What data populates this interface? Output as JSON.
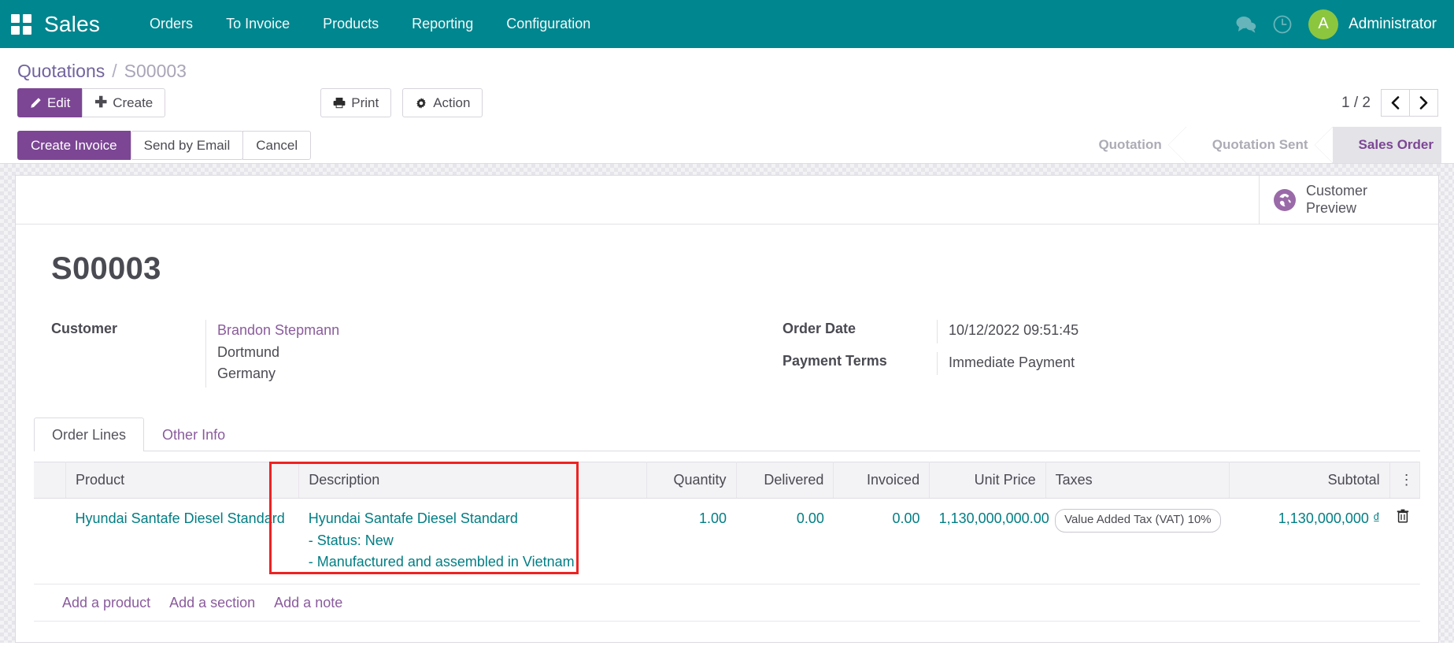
{
  "navbar": {
    "apps_icon": "apps-grid-icon",
    "brand": "Sales",
    "menu": [
      {
        "label": "Orders"
      },
      {
        "label": "To Invoice"
      },
      {
        "label": "Products"
      },
      {
        "label": "Reporting"
      },
      {
        "label": "Configuration"
      }
    ],
    "messages_icon": "chat-bubbles-icon",
    "activities_icon": "clock-icon",
    "avatar_initial": "A",
    "username": "Administrator",
    "brand_color": "#00868f",
    "avatar_color": "#8cc63f"
  },
  "breadcrumb": {
    "root": "Quotations",
    "separator": "/",
    "current": "S00003"
  },
  "toolbar": {
    "edit_label": "Edit",
    "edit_icon": "pencil-icon",
    "create_label": "Create",
    "create_icon": "plus-icon",
    "print_label": "Print",
    "print_icon": "printer-icon",
    "action_label": "Action",
    "action_icon": "gear-icon",
    "pager_value": "1 / 2",
    "pager_prev_icon": "chevron-left-icon",
    "pager_next_icon": "chevron-right-icon"
  },
  "statusbar": {
    "buttons": [
      {
        "label": "Create Invoice",
        "primary": true
      },
      {
        "label": "Send by Email",
        "primary": false
      },
      {
        "label": "Cancel",
        "primary": false
      }
    ],
    "stages": [
      {
        "label": "Quotation",
        "active": false
      },
      {
        "label": "Quotation Sent",
        "active": false
      },
      {
        "label": "Sales Order",
        "active": true
      }
    ],
    "active_color": "#7c4694"
  },
  "sheet": {
    "stat_button": {
      "icon": "globe-icon",
      "line1": "Customer",
      "line2": "Preview"
    },
    "record_title": "S00003",
    "fields_left": [
      {
        "label": "Customer",
        "value_lines": [
          "Brandon Stepmann",
          "Dortmund",
          "Germany"
        ],
        "link_first": true
      }
    ],
    "fields_right": [
      {
        "label": "Order Date",
        "value_lines": [
          "10/12/2022 09:51:45"
        ],
        "link_first": false
      },
      {
        "label": "Payment Terms",
        "value_lines": [
          "Immediate Payment"
        ],
        "link_first": false
      }
    ],
    "tabs": [
      {
        "label": "Order Lines",
        "active": true
      },
      {
        "label": "Other Info",
        "active": false
      }
    ],
    "table": {
      "columns": [
        {
          "label": "",
          "align": "left"
        },
        {
          "label": "Product",
          "align": "left"
        },
        {
          "label": "Description",
          "align": "left"
        },
        {
          "label": "Quantity",
          "align": "right"
        },
        {
          "label": "Delivered",
          "align": "right"
        },
        {
          "label": "Invoiced",
          "align": "right"
        },
        {
          "label": "Unit Price",
          "align": "right"
        },
        {
          "label": "Taxes",
          "align": "left"
        },
        {
          "label": "Subtotal",
          "align": "right"
        },
        {
          "label": "⋮",
          "align": "center"
        }
      ],
      "rows": [
        {
          "product": "Hyundai Santafe Diesel Standard",
          "description_lines": [
            "Hyundai Santafe Diesel Standard",
            "- Status: New",
            "- Manufactured and assembled in Vietnam"
          ],
          "quantity": "1.00",
          "delivered": "0.00",
          "invoiced": "0.00",
          "unit_price": "1,130,000,000.00",
          "taxes": "Value Added Tax (VAT) 10%",
          "subtotal": "1,130,000,000 ₫",
          "delete_icon": "trash-icon"
        }
      ],
      "add_links": [
        {
          "label": "Add a product"
        },
        {
          "label": "Add a section"
        },
        {
          "label": "Add a note"
        }
      ]
    },
    "annotation": {
      "highlight_color": "#ee2222",
      "highlights": "description-column"
    }
  }
}
